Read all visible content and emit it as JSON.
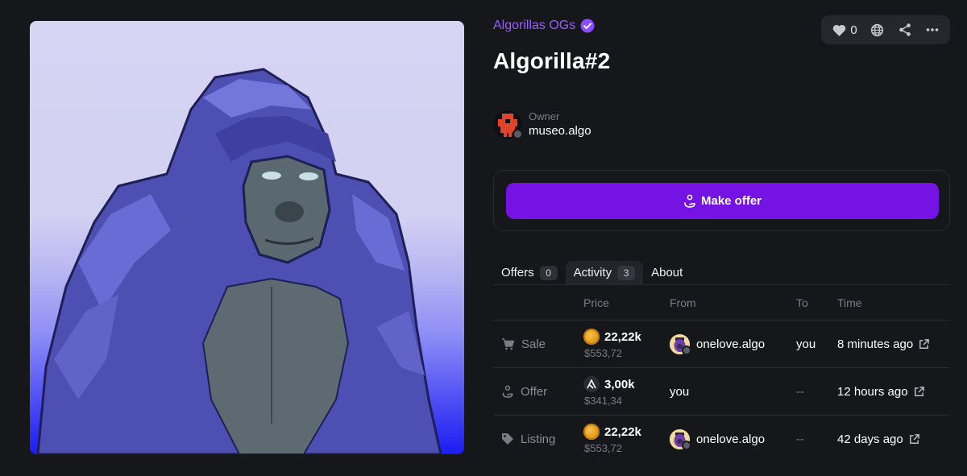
{
  "collection": {
    "name": "Algorillas OGs"
  },
  "nft": {
    "title": "Algorilla#2"
  },
  "actions": {
    "likes": "0"
  },
  "owner": {
    "label": "Owner",
    "name": "museo.algo"
  },
  "offer_button": {
    "label": "Make offer"
  },
  "tabs": [
    {
      "label": "Offers",
      "count": "0"
    },
    {
      "label": "Activity",
      "count": "3"
    },
    {
      "label": "About"
    }
  ],
  "table": {
    "headers": {
      "price": "Price",
      "from": "From",
      "to": "To",
      "time": "Time"
    },
    "rows": [
      {
        "type": "Sale",
        "type_icon": "cart-icon",
        "coin": "gold-coin-icon",
        "price": "22,22k",
        "usd": "$553,72",
        "from": "onelove.algo",
        "to": "you",
        "time": "8 minutes ago"
      },
      {
        "type": "Offer",
        "type_icon": "offer-hand-icon",
        "coin": "algo-icon",
        "price": "3,00k",
        "usd": "$341,34",
        "from": "you",
        "to": "--",
        "time": "12 hours ago"
      },
      {
        "type": "Listing",
        "type_icon": "tag-icon",
        "coin": "gold-coin-icon",
        "price": "22,22k",
        "usd": "$553,72",
        "from": "onelove.algo",
        "to": "--",
        "time": "42 days ago"
      }
    ]
  },
  "colors": {
    "accent": "#7413e3",
    "collection": "#9b5cff",
    "background": "#16171b"
  }
}
